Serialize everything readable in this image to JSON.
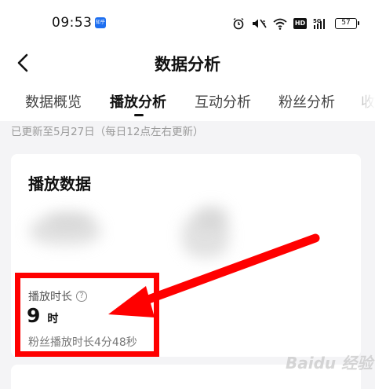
{
  "status_bar": {
    "time": "09:53",
    "app_badge": "知乎",
    "hd": "HD",
    "signal_label": "5G",
    "battery": "57"
  },
  "header": {
    "title": "数据分析"
  },
  "tabs": [
    {
      "label": "数据概览"
    },
    {
      "label": "播放分析"
    },
    {
      "label": "互动分析"
    },
    {
      "label": "粉丝分析"
    }
  ],
  "update_note": "已更新至5月27日（每日12点左右更新）",
  "card": {
    "title": "播放数据",
    "metric": {
      "label": "播放时长",
      "help": "?",
      "value": "9",
      "unit": "时",
      "sub": "粉丝播放时长4分48秒"
    }
  },
  "watermark": "Baidu 经验",
  "colors": {
    "annotation": "#ff0000",
    "app_badge": "#1e6ff0"
  }
}
